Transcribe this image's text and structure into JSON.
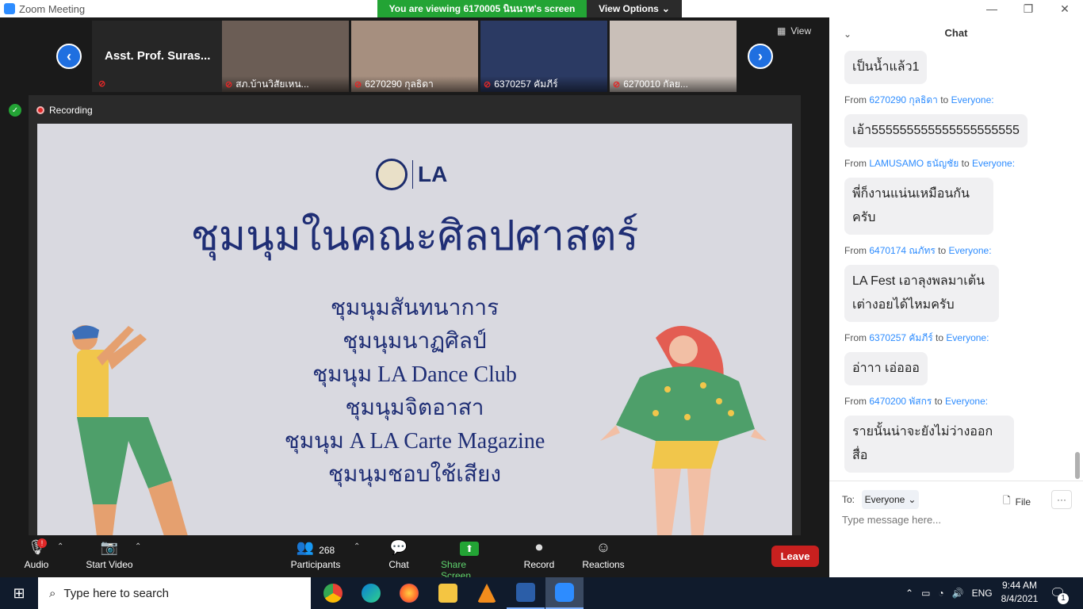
{
  "window": {
    "title": "Zoom Meeting"
  },
  "share_banner": {
    "viewing": "You are viewing 6170005 นินนาท's screen",
    "view_options": "View Options"
  },
  "strip": {
    "speaker": "Asst. Prof. Suras...",
    "tiles": [
      {
        "name": "สภ.บ้านวิสัยเหน..."
      },
      {
        "name": "6270290 กุลธิดา"
      },
      {
        "name": "6370257 คัมภีร์"
      },
      {
        "name": "6270010 กัลย..."
      }
    ],
    "view_label": "View"
  },
  "recording": {
    "label": "Recording"
  },
  "slide": {
    "logo_text": "LA",
    "title": "ชุมนุมในคณะศิลปศาสตร์",
    "clubs": [
      "ชุมนุมสันทนาการ",
      "ชุมนุมนาฏศิลป์",
      "ชุมนุม LA Dance Club",
      "ชุมนุมจิตอาสา",
      "ชุมนุม A LA Carte Magazine",
      "ชุมนุมชอบใช้เสียง"
    ]
  },
  "toolbar": {
    "audio": "Audio",
    "start_video": "Start Video",
    "participants": "Participants",
    "participants_count": "268",
    "chat": "Chat",
    "share_screen": "Share Screen",
    "record": "Record",
    "reactions": "Reactions",
    "leave": "Leave"
  },
  "chat": {
    "header": "Chat",
    "messages": [
      {
        "from": "",
        "to": "",
        "text": "เป็นน้ำแล้ว1"
      },
      {
        "from": "6270290 กุลธิดา",
        "to": "Everyone:",
        "text": "เอ้า555555555555555555555"
      },
      {
        "from": "LAMUSAMO ธนัญชัย",
        "to": "Everyone:",
        "text": "พี่ก็งานแน่นเหมือนกัน ครับ"
      },
      {
        "from": "6470174 ณภัทร",
        "to": "Everyone:",
        "text": "LA Fest เอาลุงพลมาเต้น เต่างอยได้ไหมครับ"
      },
      {
        "from": "6370257 คัมภีร์",
        "to": "Everyone:",
        "text": "อ่าาา เอ่อออ"
      },
      {
        "from": "6470200 พัสกร",
        "to": "Everyone:",
        "text": "รายนั้นน่าจะยังไม่ว่างออก สื่อ"
      }
    ],
    "from_prefix": "From",
    "to_word": "to",
    "to_label": "To:",
    "to_value": "Everyone",
    "file": "File",
    "placeholder": "Type message here..."
  },
  "taskbar": {
    "search": "Type here to search",
    "time": "9:44 AM",
    "date": "8/4/2021",
    "lang": "ENG",
    "notif_count": "1"
  },
  "colors": {
    "share_green": "#23a435",
    "zoom_blue": "#2d8cff",
    "leave_red": "#c8201f",
    "slide_text": "#1f2e75"
  }
}
